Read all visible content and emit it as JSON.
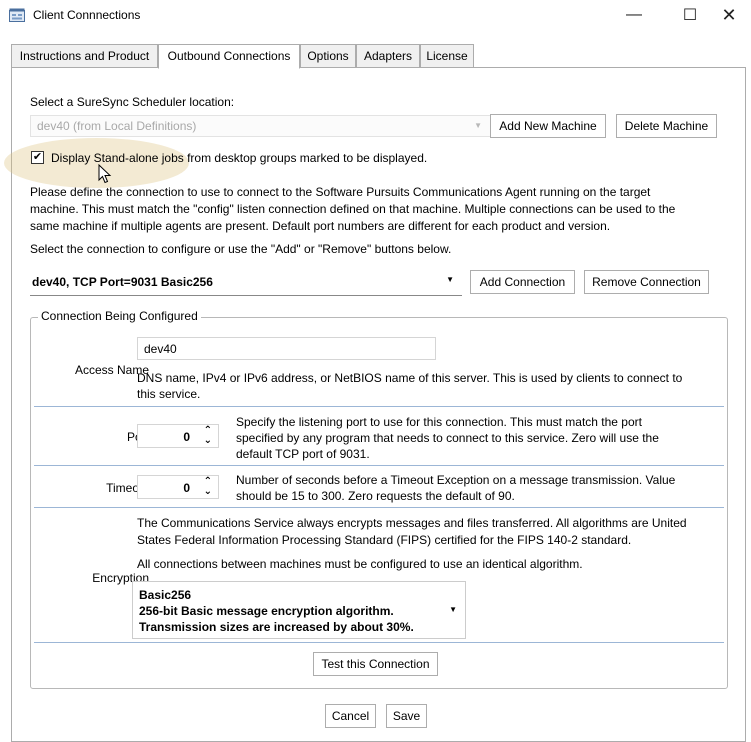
{
  "window": {
    "title": "Client Connnections",
    "minimize_glyph": "—",
    "maximize_glyph": "☐",
    "close_glyph": "✕"
  },
  "tabs": [
    {
      "label": "Instructions and Product",
      "active": false
    },
    {
      "label": "Outbound Connections",
      "active": true
    },
    {
      "label": "Options",
      "active": false
    },
    {
      "label": "Adapters",
      "active": false
    },
    {
      "label": "License",
      "active": false
    }
  ],
  "scheduler": {
    "label": "Select a SureSync Scheduler location:",
    "selected": "dev40 (from Local Definitions)",
    "add_machine": "Add New Machine",
    "delete_machine": "Delete Machine"
  },
  "standalone": {
    "checked": true,
    "label": "Display Stand-alone jobs from desktop groups marked to be displayed."
  },
  "instructions": {
    "p1_line1": "Please define the connection to use to connect to the Software Pursuits Communications Agent running on the target",
    "p1_line2": "machine. This must match the \"config\" listen connection defined on that machine. Multiple connections can be used to the",
    "p1_line3": "same machine if multiple agents are present. Default port numbers are different for each product and version.",
    "p2": "Select the connection to configure or use the \"Add\" or \"Remove\" buttons below."
  },
  "connection": {
    "selected": "dev40, TCP Port=9031 Basic256",
    "add": "Add Connection",
    "remove": "Remove Connection"
  },
  "config": {
    "legend": "Connection Being Configured",
    "access_name": {
      "label": "Access Name",
      "value": "dev40",
      "help_line1": "DNS name, IPv4 or IPv6 address, or NetBIOS name of this server. This is used by clients to connect to",
      "help_line2": "this service."
    },
    "port": {
      "label": "Port",
      "value": "0",
      "help_line1": "Specify the listening port to use for this connection. This must match the port",
      "help_line2": "specified by any program that needs to connect to this service. Zero will use the",
      "help_line3": "default TCP port of 9031."
    },
    "timeout": {
      "label": "Timeout",
      "value": "0",
      "help_line1": "Number of seconds before a Timeout Exception on a message transmission. Value",
      "help_line2": "should be 15 to 300. Zero requests the default of 90."
    },
    "encryption": {
      "label": "Encryption",
      "help_line1": "The Communications Service always encrypts messages and files transferred. All algorithms are United",
      "help_line2": "States Federal Information Processing Standard (FIPS) certified for the FIPS 140-2 standard.",
      "help_line3": "All connections between machines must be configured to use an identical algorithm.",
      "option_name": "Basic256",
      "option_desc1": "256-bit Basic message encryption algorithm.",
      "option_desc2": "Transmission sizes are increased by about 30%."
    },
    "test": "Test this Connection"
  },
  "footer": {
    "cancel": "Cancel",
    "save": "Save"
  },
  "icons": {
    "spin": "⌃⌄",
    "dropdown": "▼",
    "check": "✔"
  }
}
